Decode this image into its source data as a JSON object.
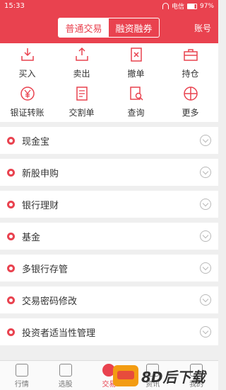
{
  "status": {
    "time": "15:33",
    "carrier": "电信",
    "battery": "97%"
  },
  "header": {
    "tabs": [
      {
        "label": "普通交易"
      },
      {
        "label": "融资融券"
      }
    ],
    "account": "账号"
  },
  "grid": [
    {
      "label": "买入",
      "icon": "download-box-icon"
    },
    {
      "label": "卖出",
      "icon": "upload-box-icon"
    },
    {
      "label": "撤单",
      "icon": "cancel-doc-icon"
    },
    {
      "label": "持仓",
      "icon": "briefcase-icon"
    },
    {
      "label": "银证转账",
      "icon": "yuan-transfer-icon"
    },
    {
      "label": "交割单",
      "icon": "scroll-doc-icon"
    },
    {
      "label": "查询",
      "icon": "search-doc-icon"
    },
    {
      "label": "更多",
      "icon": "more-grid-icon"
    }
  ],
  "list": [
    {
      "label": "现金宝"
    },
    {
      "label": "新股申购"
    },
    {
      "label": "银行理财"
    },
    {
      "label": "基金"
    },
    {
      "label": "多银行存管"
    },
    {
      "label": "交易密码修改"
    },
    {
      "label": "投资者适当性管理"
    }
  ],
  "tabbar": [
    {
      "label": "行情"
    },
    {
      "label": "选股"
    },
    {
      "label": "交易"
    },
    {
      "label": "资讯"
    },
    {
      "label": "我的"
    }
  ],
  "watermark": {
    "text": "8D后下载"
  },
  "colors": {
    "accent": "#e9424f"
  }
}
